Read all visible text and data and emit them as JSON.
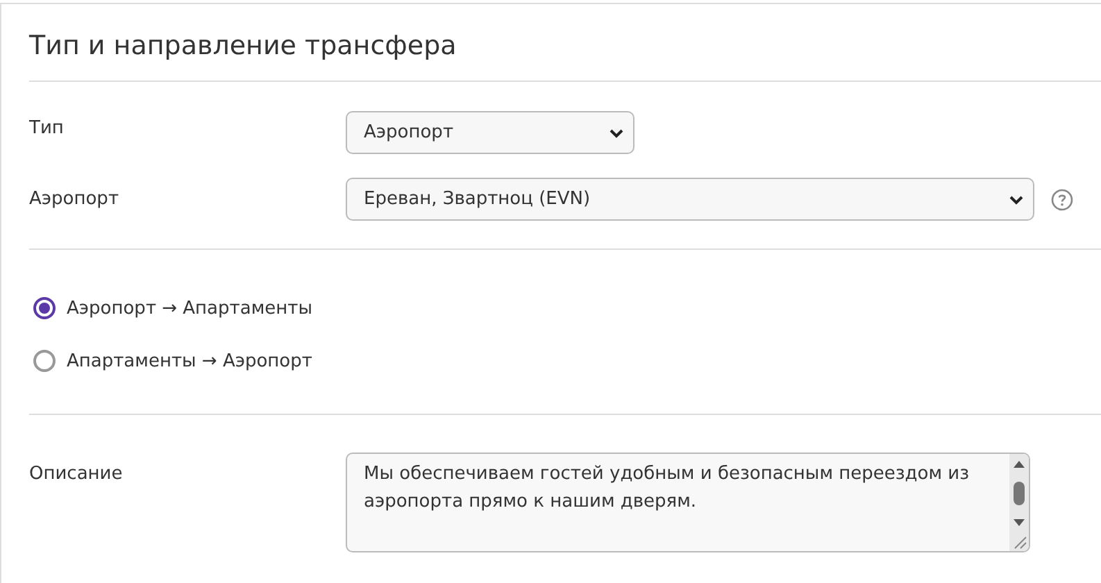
{
  "panel": {
    "title": "Тип и направление трансфера"
  },
  "fields": [
    {
      "label": "Тип",
      "value": "Аэропорт",
      "kind": "select",
      "wide": false,
      "help": false
    },
    {
      "label": "Аэропорт",
      "value": "Ереван, Звартноц (EVN)",
      "kind": "select",
      "wide": true,
      "help": true
    }
  ],
  "direction": [
    {
      "label": "Аэропорт → Апартаменты",
      "selected": true
    },
    {
      "label": "Апартаменты → Аэропорт",
      "selected": false
    }
  ],
  "description": {
    "label": "Описание",
    "lines": [
      "Мы обеспечиваем гостей удобным и безопасным переездом из",
      "аэропорта прямо к нашим дверям."
    ]
  }
}
